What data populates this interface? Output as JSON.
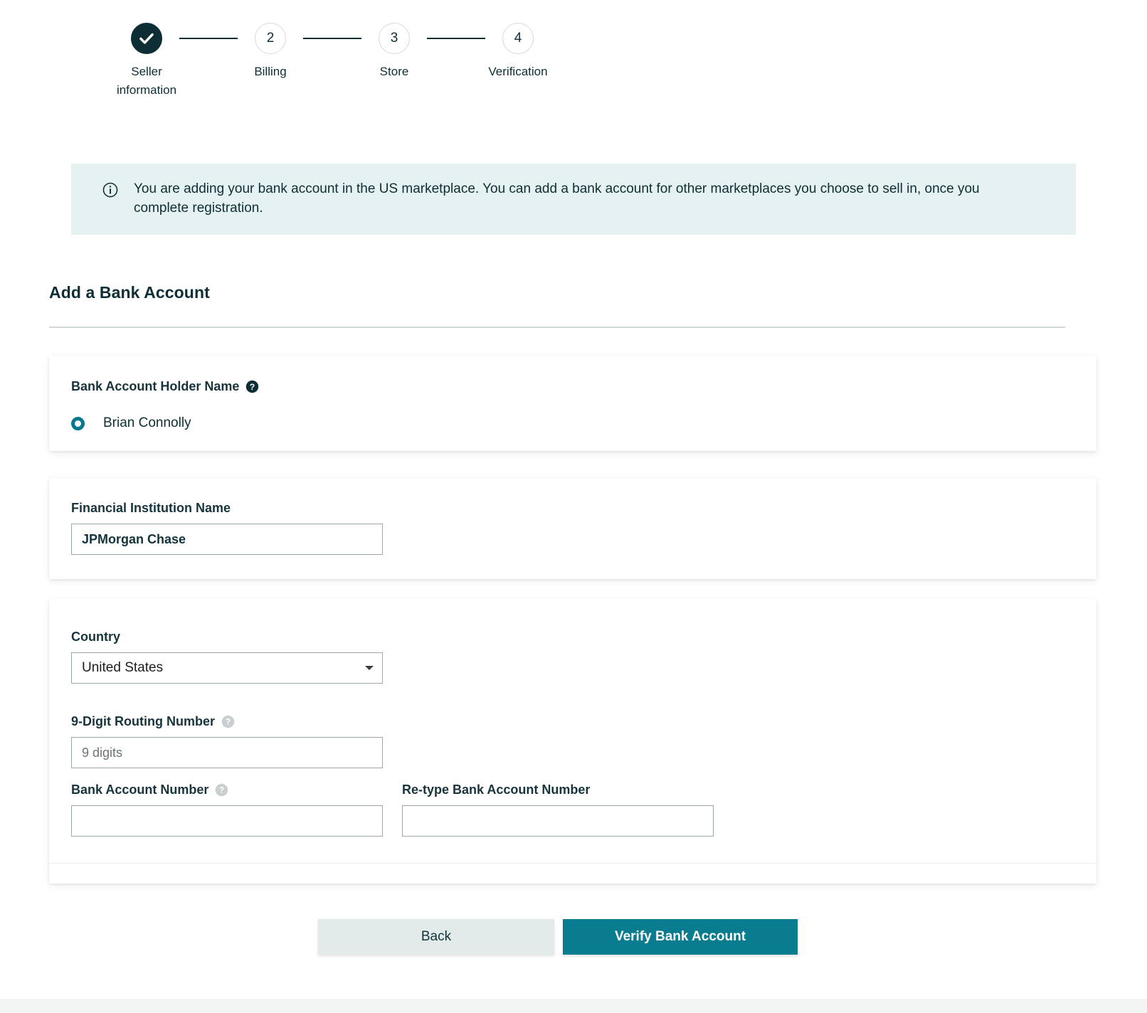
{
  "stepper": {
    "steps": [
      {
        "number": "1",
        "label": "Seller information",
        "state": "completed",
        "icon": "check-icon"
      },
      {
        "number": "2",
        "label": "Billing",
        "state": "upcoming"
      },
      {
        "number": "3",
        "label": "Store",
        "state": "upcoming"
      },
      {
        "number": "4",
        "label": "Verification",
        "state": "upcoming"
      }
    ]
  },
  "banner": {
    "icon": "info-circle-icon",
    "text": "You are adding your bank account in the US marketplace. You can add a bank account for other marketplaces you choose to sell in, once you complete registration.",
    "background": "#e6f2f2"
  },
  "section": {
    "title": "Add a Bank Account"
  },
  "holder": {
    "label": "Bank Account Holder Name",
    "help_icon": "help-circle-filled-icon",
    "option_label": "Brian Connolly",
    "selected": true
  },
  "institution": {
    "label": "Financial Institution Name",
    "value": "JPMorgan Chase",
    "placeholder": ""
  },
  "country": {
    "label": "Country",
    "value": "United States",
    "options": [
      "United States"
    ],
    "caret_icon": "chevron-down-icon"
  },
  "routing": {
    "label": "9-Digit Routing Number",
    "help_icon": "help-circle-icon",
    "value": "",
    "placeholder": "9 digits"
  },
  "account_number": {
    "label": "Bank Account Number",
    "help_icon": "help-circle-icon",
    "value": "",
    "placeholder": ""
  },
  "account_number_retype": {
    "label": "Re-type Bank Account Number",
    "value": "",
    "placeholder": ""
  },
  "footer": {
    "back_label": "Back",
    "verify_label": "Verify Bank Account"
  },
  "colors": {
    "accent_teal": "#0a7c8f",
    "dark_navy": "#0d2e35",
    "banner_bg": "#e6f2f2",
    "back_button_bg": "#e3eaea"
  }
}
